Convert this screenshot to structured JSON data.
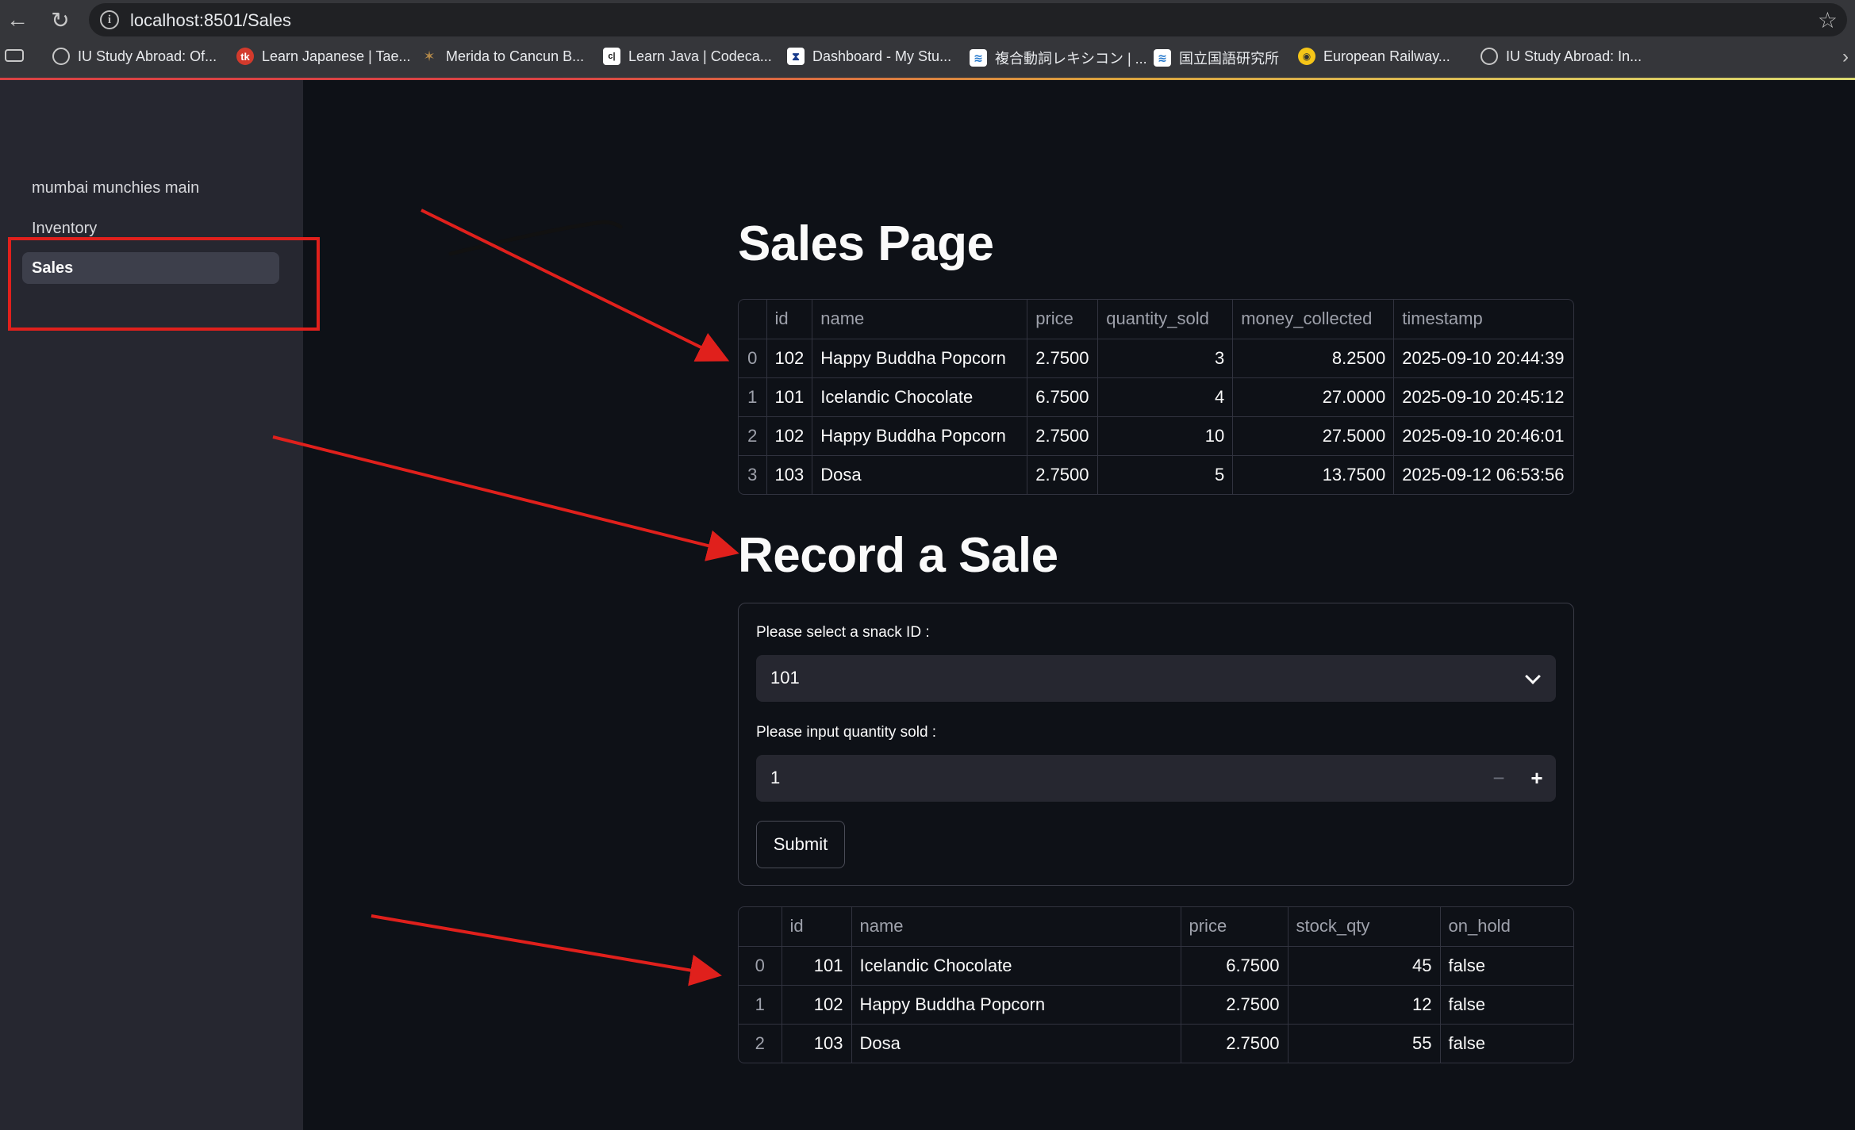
{
  "browser": {
    "url": "localhost:8501/Sales",
    "bookmarks": [
      {
        "label": "IU Study Abroad: Of...",
        "icon": "globe-icon"
      },
      {
        "label": "Learn Japanese | Tae...",
        "icon": "tk-icon",
        "badge": "tk"
      },
      {
        "label": "Merida to Cancun B...",
        "icon": "bus-icon"
      },
      {
        "label": "Learn Java | Codeca...",
        "icon": "codecademy-icon",
        "badge": "c|"
      },
      {
        "label": "Dashboard - My Stu...",
        "icon": "dashboard-icon"
      },
      {
        "label": "複合動詞レキシコン | ...",
        "icon": "lexicon-icon"
      },
      {
        "label": "国立国語研究所",
        "icon": "ninjal-icon"
      },
      {
        "label": "European Railway...",
        "icon": "railway-icon"
      },
      {
        "label": "IU Study Abroad: In...",
        "icon": "globe-icon"
      }
    ]
  },
  "sidebar": {
    "items": [
      {
        "label": "mumbai munchies main"
      },
      {
        "label": "Inventory"
      },
      {
        "label": "Sales"
      }
    ],
    "active": "Sales"
  },
  "page": {
    "title": "Sales Page",
    "sales_table": {
      "columns": [
        "",
        "id",
        "name",
        "price",
        "quantity_sold",
        "money_collected",
        "timestamp"
      ],
      "rows": [
        [
          "0",
          "102",
          "Happy Buddha Popcorn",
          "2.7500",
          "3",
          "8.2500",
          "2025-09-10 20:44:39"
        ],
        [
          "1",
          "101",
          "Icelandic Chocolate",
          "6.7500",
          "4",
          "27.0000",
          "2025-09-10 20:45:12"
        ],
        [
          "2",
          "102",
          "Happy Buddha Popcorn",
          "2.7500",
          "10",
          "27.5000",
          "2025-09-10 20:46:01"
        ],
        [
          "3",
          "103",
          "Dosa",
          "2.7500",
          "5",
          "13.7500",
          "2025-09-12 06:53:56"
        ]
      ]
    },
    "record_title": "Record a Sale",
    "form": {
      "select_label": "Please select a snack ID :",
      "select_value": "101",
      "qty_label": "Please input quantity sold :",
      "qty_value": "1",
      "minus": "−",
      "plus": "+",
      "submit_label": "Submit"
    },
    "inventory_table": {
      "columns": [
        "",
        "id",
        "name",
        "price",
        "stock_qty",
        "on_hold"
      ],
      "rows": [
        [
          "0",
          "101",
          "Icelandic Chocolate",
          "6.7500",
          "45",
          "false"
        ],
        [
          "1",
          "102",
          "Happy Buddha Popcorn",
          "2.7500",
          "12",
          "false"
        ],
        [
          "2",
          "103",
          "Dosa",
          "2.7500",
          "55",
          "false"
        ]
      ]
    }
  },
  "colors": {
    "background": "#0e1117",
    "sidebar": "#262730",
    "annotation_red": "#e0201c"
  }
}
